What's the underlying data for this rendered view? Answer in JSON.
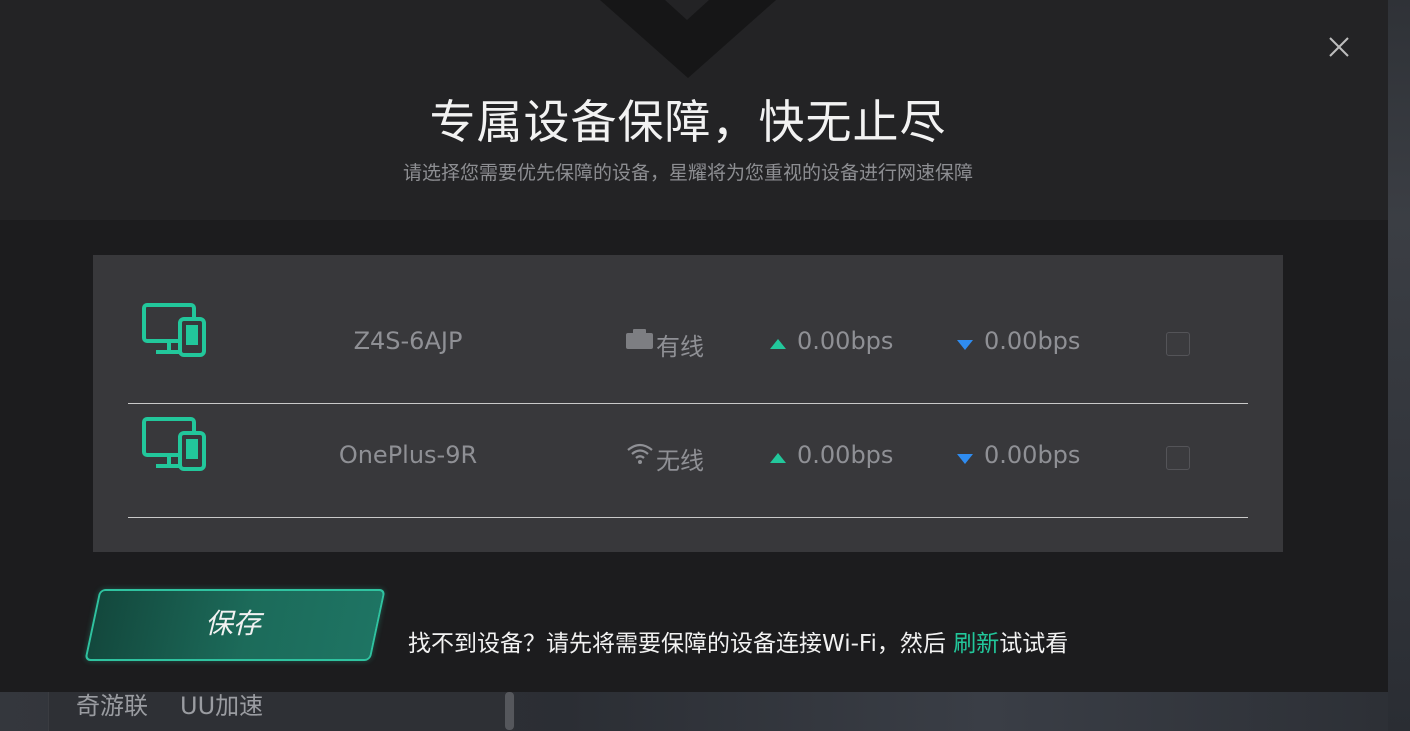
{
  "background": {
    "card_labels": [
      "奇游联",
      "UU加速"
    ]
  },
  "dialog": {
    "title": "专属设备保障，快无止尽",
    "subtitle": "请选择您需要优先保障的设备，星耀将为您重视的设备进行网速保障",
    "devices": [
      {
        "name": "Z4S-6AJP",
        "connection": "有线",
        "connection_icon": "ethernet-icon",
        "upload": "0.00bps",
        "download": "0.00bps",
        "checked": false
      },
      {
        "name": "OnePlus-9R",
        "connection": "无线",
        "connection_icon": "wifi-icon",
        "upload": "0.00bps",
        "download": "0.00bps",
        "checked": false
      }
    ],
    "save_label": "保存",
    "hint_prefix": "找不到设备？请先将需要保障的设备连接Wi-Fi，然后 ",
    "hint_link": "刷新",
    "hint_suffix": "试试看"
  },
  "colors": {
    "accent": "#22c79b",
    "download": "#2f8cf0",
    "dialog_bg": "#1c1c1e",
    "panel_bg": "#38383b"
  }
}
